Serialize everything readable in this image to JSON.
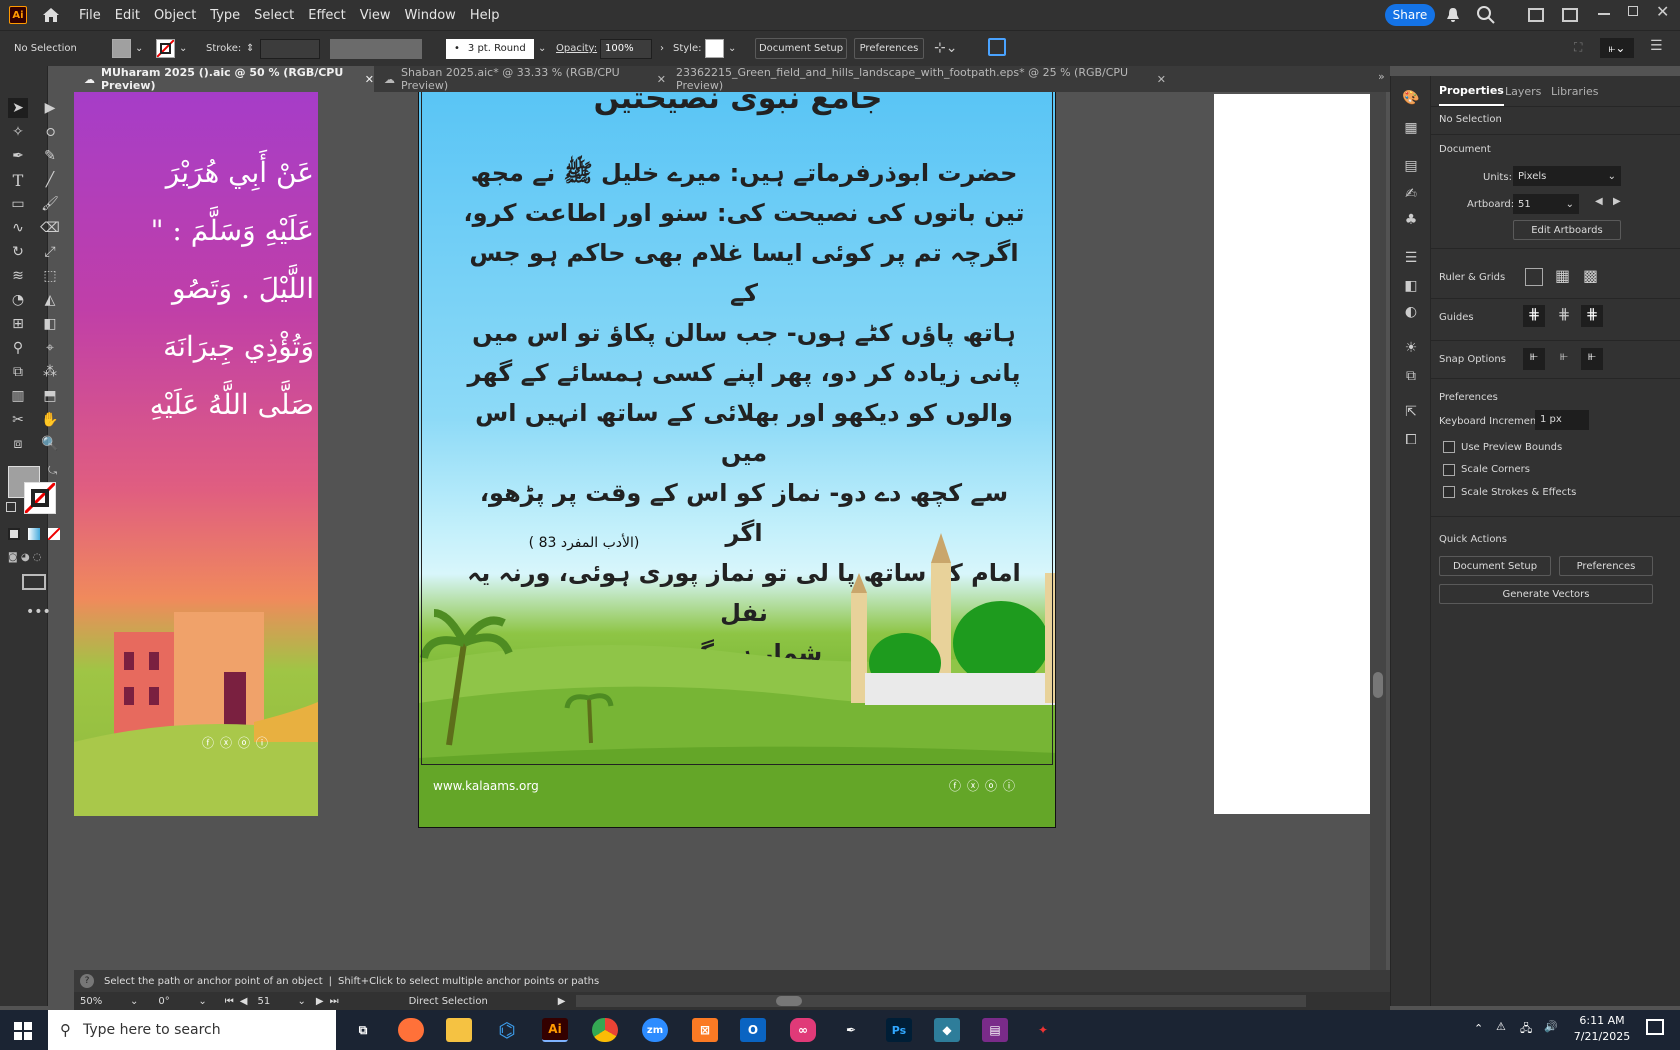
{
  "menubar": {
    "logo": "Ai",
    "items": [
      "File",
      "Edit",
      "Object",
      "Type",
      "Select",
      "Effect",
      "View",
      "Window",
      "Help"
    ],
    "share_label": "Share"
  },
  "control": {
    "selection": "No Selection",
    "stroke_label": "Stroke:",
    "brush": "3 pt. Round",
    "opacity_label": "Opacity:",
    "opacity_value": "100%",
    "style_label": "Style:",
    "doc_setup": "Document Setup",
    "preferences": "Preferences"
  },
  "tabs": [
    {
      "label": "MUharam 2025 ().aic @ 50 % (RGB/CPU Preview)",
      "active": true
    },
    {
      "label": "Shaban 2025.aic* @ 33.33 % (RGB/CPU Preview)",
      "active": false
    },
    {
      "label": "23362215_Green_field_and_hills_landscape_with_footpath.eps* @ 25 % (RGB/CPU Preview)",
      "active": false
    }
  ],
  "artboard_left": {
    "lines": [
      "عَنْ أَبِي هُرَيْرَ",
      "عَلَيْهِ وَسَلَّمَ : \"",
      "اللَّيْلَ . وَتَصُو",
      "وَتُؤْذِي جِيرَانَهَ",
      "صَلَّى اللَّهُ عَلَيْهِ"
    ]
  },
  "artboard_main": {
    "title": "جامع نبوی نصیحتیں",
    "lines": [
      "حضرت ابوذرفرماتے ہیں: میرے خلیل ﷺ نے مجھ",
      "تین باتوں کی نصیحت کی: سنو اور اطاعت کرو،",
      "اگرچہ تم پر کوئی ایسا غلام بھی حاکم ہو جس کے",
      "ہاتھ پاؤں کٹے ہوں- جب سالن پکاؤ تو اس میں",
      "پانی زیادہ کر دو، پھر اپنے کسی ہمسائے کے گھر",
      "والوں کو دیکھو اور بھلائی کے ساتھ انہیں اس میں",
      "سے کچھ دے دو- نماز کو اس کے وقت پر پڑھو، اگر",
      "امام کے ساتھ پا لی تو نماز پوری ہوئی، ورنہ یہ نفل",
      "شمار ہو گی-"
    ],
    "reference": "(الأدب المفرد 83 )",
    "website": "www.kalaams.org"
  },
  "panel": {
    "tabs": [
      "Properties",
      "Layers",
      "Libraries"
    ],
    "no_selection": "No Selection",
    "document": "Document",
    "units_label": "Units:",
    "units_value": "Pixels",
    "artboard_label": "Artboard:",
    "artboard_value": "51",
    "edit_artboards": "Edit Artboards",
    "ruler_grids": "Ruler & Grids",
    "guides": "Guides",
    "snap_options": "Snap Options",
    "preferences": "Preferences",
    "keyboard_inc_label": "Keyboard Increment:",
    "keyboard_inc_value": "1 px",
    "use_preview_bounds": "Use Preview Bounds",
    "scale_corners": "Scale Corners",
    "scale_strokes": "Scale Strokes & Effects",
    "quick_actions": "Quick Actions",
    "doc_setup_btn": "Document Setup",
    "prefs_btn": "Preferences",
    "gen_vectors": "Generate Vectors"
  },
  "status": {
    "hint": "Select the path or anchor point of an object",
    "hint2": "Shift+Click to select multiple anchor points or paths",
    "zoom": "50%",
    "rotation": "0°",
    "artboard": "51",
    "tool": "Direct Selection"
  },
  "taskbar": {
    "search_placeholder": "Type here to search",
    "time": "6:11 AM",
    "date": "7/21/2025"
  }
}
